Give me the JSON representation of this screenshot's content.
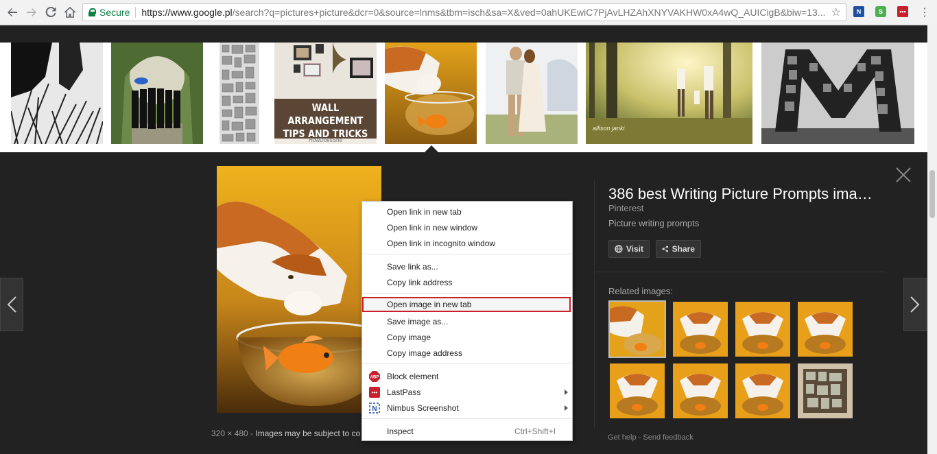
{
  "browser": {
    "secure_label": "Secure",
    "url_host": "https://www.google.pl",
    "url_rest": "/search?q=pictures+picture&dcr=0&source=lnms&tbm=isch&sa=X&ved=0ahUKEwiC7PjAvLHZAhXNYVAKHW0xA4wQ_AUICigB&biw=13...",
    "extensions": [
      {
        "name": "nimbus-extension-icon",
        "label": "N",
        "color": "#1e4fa0"
      },
      {
        "name": "s-extension-icon",
        "label": "S",
        "color": "#4caf50"
      },
      {
        "name": "lastpass-extension-icon",
        "label": "•••",
        "color": "#c8202c"
      }
    ]
  },
  "viewer": {
    "image_size": "320 × 480",
    "image_notice": "Images may be subject to co",
    "title": "386 best Writing Picture Prompts ima…",
    "source": "Pinterest",
    "subtitle": "Picture writing prompts",
    "visit_label": "Visit",
    "share_label": "Share",
    "related_label": "Related images:",
    "help_label": "Get help",
    "feedback_label": "Send feedback",
    "link_separator": "-"
  },
  "strip": {
    "thumb_3_caption_1": "WALL ARRANGEMENT",
    "thumb_3_caption_2": "TIPS AND TRICKS",
    "thumb_3_footer": "HowDoesShe",
    "thumb_7_watermark": "allison janki"
  },
  "context_menu": {
    "open_new_tab": "Open link in new tab",
    "open_new_window": "Open link in new window",
    "open_incognito": "Open link in incognito window",
    "save_link": "Save link as...",
    "copy_link": "Copy link address",
    "open_image": "Open image in new tab",
    "save_image": "Save image as...",
    "copy_image": "Copy image",
    "copy_image_address": "Copy image address",
    "block_element": "Block element",
    "lastpass": "LastPass",
    "nimbus": "Nimbus Screenshot",
    "inspect": "Inspect",
    "inspect_shortcut": "Ctrl+Shift+I",
    "abp_icon_text": "ABP",
    "nimbus_icon_text": "N",
    "lastpass_icon_text": "•••"
  }
}
